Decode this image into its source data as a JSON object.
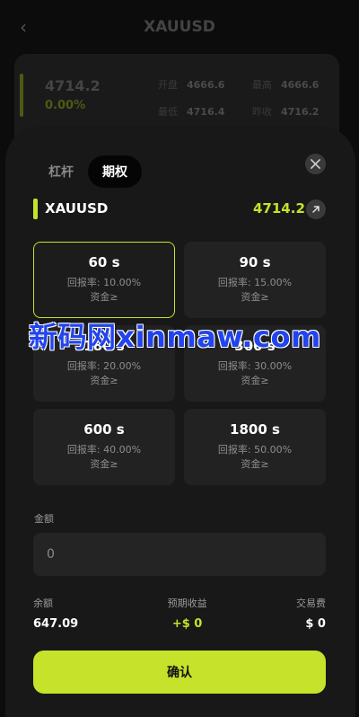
{
  "background": {
    "title": "XAUUSD",
    "price": "4714.2",
    "change": "0.00%",
    "stats": [
      {
        "label": "开盘",
        "value": "4666.6"
      },
      {
        "label": "最高",
        "value": "4666.6"
      },
      {
        "label": "最低",
        "value": "4716.4"
      },
      {
        "label": "昨收",
        "value": "4716.2"
      }
    ]
  },
  "tabs": [
    {
      "label": "杠杆",
      "active": false
    },
    {
      "label": "期权",
      "active": true
    }
  ],
  "symbol": {
    "name": "XAUUSD",
    "price": "4714.2"
  },
  "options": [
    {
      "duration": "60 s",
      "rate": "回报率: 10.00%",
      "fund": "资金≥",
      "selected": true
    },
    {
      "duration": "90 s",
      "rate": "回报率: 15.00%",
      "fund": "资金≥",
      "selected": false
    },
    {
      "duration": "180 s",
      "rate": "回报率: 20.00%",
      "fund": "资金≥",
      "selected": false
    },
    {
      "duration": "300 s",
      "rate": "回报率: 30.00%",
      "fund": "资金≥",
      "selected": false
    },
    {
      "duration": "600 s",
      "rate": "回报率: 40.00%",
      "fund": "资金≥",
      "selected": false
    },
    {
      "duration": "1800 s",
      "rate": "回报率: 50.00%",
      "fund": "资金≥",
      "selected": false
    }
  ],
  "amount": {
    "label": "金额",
    "value": "",
    "placeholder": "0"
  },
  "summary": {
    "balance_label": "余额",
    "balance_value": "647.09",
    "expected_label": "预期收益",
    "expected_value": "+$ 0",
    "fee_label": "交易费",
    "fee_value": "$ 0"
  },
  "confirm_label": "确认",
  "watermark": "新码网xinmaw.com",
  "colors": {
    "accent": "#c6e22a",
    "sheet": "#181818",
    "card": "#222222"
  }
}
